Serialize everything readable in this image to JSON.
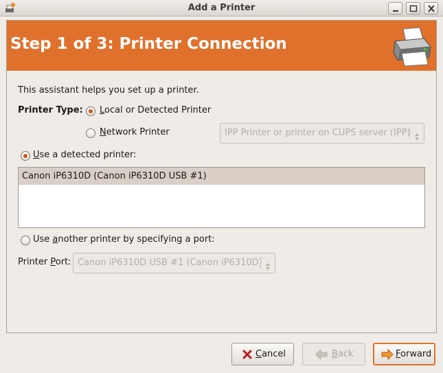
{
  "window": {
    "title": "Add a Printer",
    "icon": "printer-app-icon"
  },
  "banner": {
    "title": "Step 1 of 3: Printer Connection",
    "icon": "printer-icon",
    "color": "#e0712c"
  },
  "intro_text": "This assistant helps you set up a printer.",
  "printer_type": {
    "label": "Printer Type:",
    "options": [
      {
        "label_pre": "",
        "mnemonic": "L",
        "label_post": "ocal or Detected Printer",
        "checked": true
      },
      {
        "label_pre": "",
        "mnemonic": "N",
        "label_post": "etwork Printer",
        "checked": false
      }
    ],
    "network_select": {
      "value": "IPP Printer or printer on CUPS server (IPP)",
      "enabled": false
    }
  },
  "detected": {
    "label_pre": "",
    "mnemonic": "U",
    "label_post": "se a detected printer:",
    "checked": true,
    "printers": [
      "Canon iP6310D (Canon iP6310D USB #1)"
    ]
  },
  "another": {
    "label_pre": "Use ",
    "mnemonic": "a",
    "label_post": "nother printer by specifying a port:",
    "checked": false
  },
  "port": {
    "label_pre": "Printer ",
    "mnemonic": "P",
    "label_post": "ort:",
    "value": "Canon iP6310D USB #1 (Canon iP6310D)",
    "enabled": false
  },
  "buttons": {
    "cancel": {
      "mnemonic": "C",
      "rest": "ancel",
      "icon": "cancel-x-icon",
      "enabled": true
    },
    "back": {
      "mnemonic": "B",
      "rest": "ack",
      "icon": "back-arrow-icon",
      "enabled": false
    },
    "forward": {
      "mnemonic": "F",
      "rest": "orward",
      "icon": "forward-arrow-icon",
      "enabled": true,
      "default": true
    }
  }
}
